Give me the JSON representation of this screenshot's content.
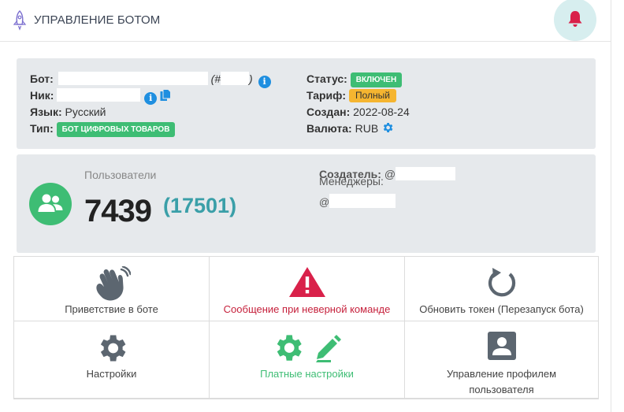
{
  "header": {
    "title": "УПРАВЛЕНИЕ БОТОМ",
    "rocket_icon": "rocket-icon",
    "bell_icon": "bell-icon"
  },
  "info": {
    "bot_label": "Бот:",
    "bot_hash": "(#",
    "bot_close": ")",
    "nick_label": "Ник:",
    "lang_label": "Язык:",
    "lang_value": "Русский",
    "type_label": "Тип:",
    "type_value": "БОТ ЦИФРОВЫХ ТОВАРОВ",
    "status_label": "Статус:",
    "status_value": "ВКЛЮЧЕН",
    "tariff_label": "Тариф:",
    "tariff_value": "Полный",
    "created_label": "Создан:",
    "created_value": "2022-08-24",
    "currency_label": "Валюта:",
    "currency_value": "RUB"
  },
  "users": {
    "label": "Пользователи",
    "count": "7439",
    "total": "(17501)",
    "creator_label": "Создатель:",
    "creator_at": "@",
    "managers_label": "Менеджеры:",
    "manager_at": "@"
  },
  "actions": [
    {
      "label": "Приветствие в боте",
      "icon": "waving-hand-icon"
    },
    {
      "label": "Сообщение при неверной команде",
      "icon": "warning-triangle-icon"
    },
    {
      "label": "Обновить токен (Перезапуск бота)",
      "icon": "refresh-icon"
    },
    {
      "label": "Настройки",
      "icon": "gear-icon"
    },
    {
      "label": "Платные настройки",
      "icon": "gear-edit-icon"
    },
    {
      "label": "Управление профилем пользователя",
      "icon": "user-profile-icon"
    }
  ],
  "colors": {
    "green": "#3ebd74",
    "yellow": "#f5b530",
    "red": "#d9214a",
    "teal": "#3a9fa8",
    "info_blue": "#1f8fe0",
    "icon_gray": "#5c6670"
  }
}
